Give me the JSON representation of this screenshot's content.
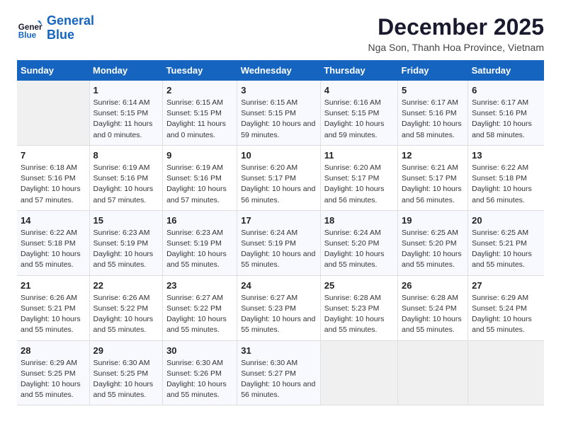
{
  "logo": {
    "line1": "General",
    "line2": "Blue"
  },
  "title": "December 2025",
  "subtitle": "Nga Son, Thanh Hoa Province, Vietnam",
  "days_header": [
    "Sunday",
    "Monday",
    "Tuesday",
    "Wednesday",
    "Thursday",
    "Friday",
    "Saturday"
  ],
  "weeks": [
    [
      {
        "day": "",
        "empty": true
      },
      {
        "day": "1",
        "sunrise": "6:14 AM",
        "sunset": "5:15 PM",
        "daylight": "11 hours and 0 minutes."
      },
      {
        "day": "2",
        "sunrise": "6:15 AM",
        "sunset": "5:15 PM",
        "daylight": "11 hours and 0 minutes."
      },
      {
        "day": "3",
        "sunrise": "6:15 AM",
        "sunset": "5:15 PM",
        "daylight": "10 hours and 59 minutes."
      },
      {
        "day": "4",
        "sunrise": "6:16 AM",
        "sunset": "5:15 PM",
        "daylight": "10 hours and 59 minutes."
      },
      {
        "day": "5",
        "sunrise": "6:17 AM",
        "sunset": "5:16 PM",
        "daylight": "10 hours and 58 minutes."
      },
      {
        "day": "6",
        "sunrise": "6:17 AM",
        "sunset": "5:16 PM",
        "daylight": "10 hours and 58 minutes."
      }
    ],
    [
      {
        "day": "7",
        "sunrise": "6:18 AM",
        "sunset": "5:16 PM",
        "daylight": "10 hours and 57 minutes."
      },
      {
        "day": "8",
        "sunrise": "6:19 AM",
        "sunset": "5:16 PM",
        "daylight": "10 hours and 57 minutes."
      },
      {
        "day": "9",
        "sunrise": "6:19 AM",
        "sunset": "5:16 PM",
        "daylight": "10 hours and 57 minutes."
      },
      {
        "day": "10",
        "sunrise": "6:20 AM",
        "sunset": "5:17 PM",
        "daylight": "10 hours and 56 minutes."
      },
      {
        "day": "11",
        "sunrise": "6:20 AM",
        "sunset": "5:17 PM",
        "daylight": "10 hours and 56 minutes."
      },
      {
        "day": "12",
        "sunrise": "6:21 AM",
        "sunset": "5:17 PM",
        "daylight": "10 hours and 56 minutes."
      },
      {
        "day": "13",
        "sunrise": "6:22 AM",
        "sunset": "5:18 PM",
        "daylight": "10 hours and 56 minutes."
      }
    ],
    [
      {
        "day": "14",
        "sunrise": "6:22 AM",
        "sunset": "5:18 PM",
        "daylight": "10 hours and 55 minutes."
      },
      {
        "day": "15",
        "sunrise": "6:23 AM",
        "sunset": "5:19 PM",
        "daylight": "10 hours and 55 minutes."
      },
      {
        "day": "16",
        "sunrise": "6:23 AM",
        "sunset": "5:19 PM",
        "daylight": "10 hours and 55 minutes."
      },
      {
        "day": "17",
        "sunrise": "6:24 AM",
        "sunset": "5:19 PM",
        "daylight": "10 hours and 55 minutes."
      },
      {
        "day": "18",
        "sunrise": "6:24 AM",
        "sunset": "5:20 PM",
        "daylight": "10 hours and 55 minutes."
      },
      {
        "day": "19",
        "sunrise": "6:25 AM",
        "sunset": "5:20 PM",
        "daylight": "10 hours and 55 minutes."
      },
      {
        "day": "20",
        "sunrise": "6:25 AM",
        "sunset": "5:21 PM",
        "daylight": "10 hours and 55 minutes."
      }
    ],
    [
      {
        "day": "21",
        "sunrise": "6:26 AM",
        "sunset": "5:21 PM",
        "daylight": "10 hours and 55 minutes."
      },
      {
        "day": "22",
        "sunrise": "6:26 AM",
        "sunset": "5:22 PM",
        "daylight": "10 hours and 55 minutes."
      },
      {
        "day": "23",
        "sunrise": "6:27 AM",
        "sunset": "5:22 PM",
        "daylight": "10 hours and 55 minutes."
      },
      {
        "day": "24",
        "sunrise": "6:27 AM",
        "sunset": "5:23 PM",
        "daylight": "10 hours and 55 minutes."
      },
      {
        "day": "25",
        "sunrise": "6:28 AM",
        "sunset": "5:23 PM",
        "daylight": "10 hours and 55 minutes."
      },
      {
        "day": "26",
        "sunrise": "6:28 AM",
        "sunset": "5:24 PM",
        "daylight": "10 hours and 55 minutes."
      },
      {
        "day": "27",
        "sunrise": "6:29 AM",
        "sunset": "5:24 PM",
        "daylight": "10 hours and 55 minutes."
      }
    ],
    [
      {
        "day": "28",
        "sunrise": "6:29 AM",
        "sunset": "5:25 PM",
        "daylight": "10 hours and 55 minutes."
      },
      {
        "day": "29",
        "sunrise": "6:30 AM",
        "sunset": "5:25 PM",
        "daylight": "10 hours and 55 minutes."
      },
      {
        "day": "30",
        "sunrise": "6:30 AM",
        "sunset": "5:26 PM",
        "daylight": "10 hours and 55 minutes."
      },
      {
        "day": "31",
        "sunrise": "6:30 AM",
        "sunset": "5:27 PM",
        "daylight": "10 hours and 56 minutes."
      },
      {
        "day": "",
        "empty": true
      },
      {
        "day": "",
        "empty": true
      },
      {
        "day": "",
        "empty": true
      }
    ]
  ]
}
